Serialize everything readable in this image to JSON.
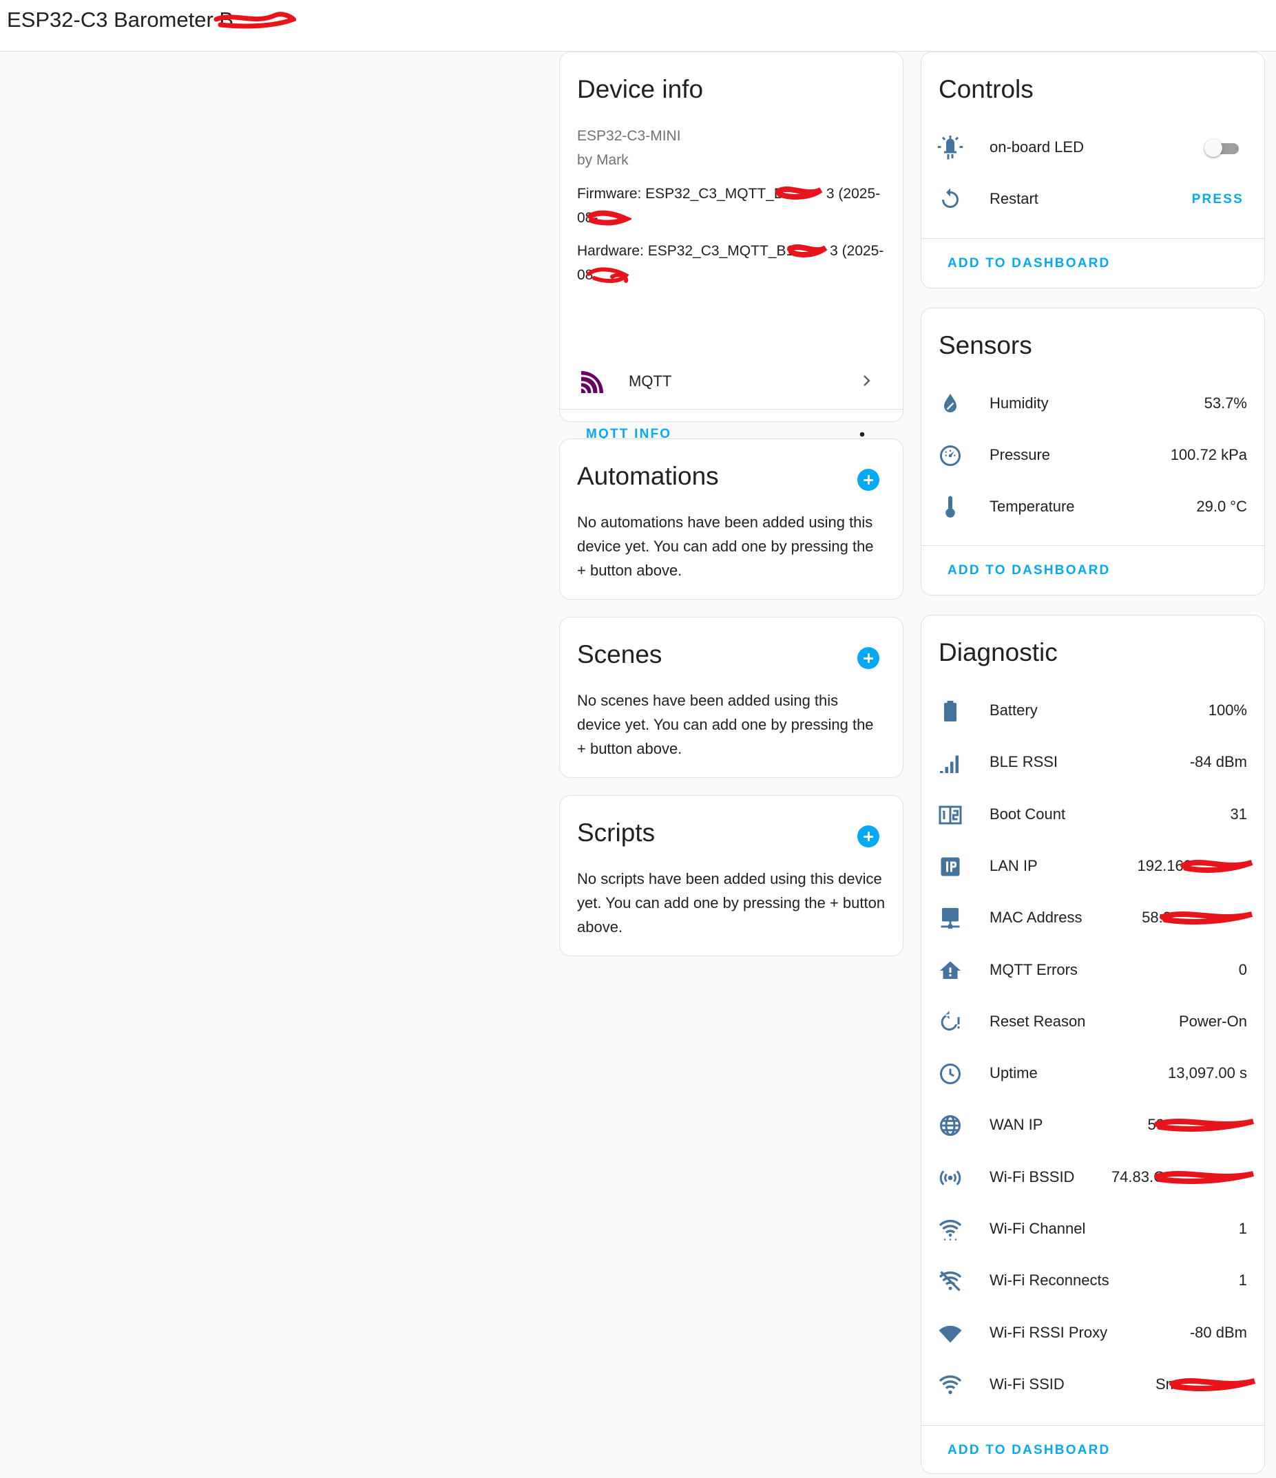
{
  "header": {
    "title": "ESP32-C3 Barometer B"
  },
  "device_info": {
    "title": "Device info",
    "model": "ESP32-C3-MINI",
    "manufacturer": "by Mark",
    "firmware_line1": "Firmware: ESP32_C3_MQTT_B",
    "firmware_line1_tail": "3 (2025-",
    "firmware_line2": "08-",
    "hardware_line1": "Hardware: ESP32_C3_MQTT_B1",
    "hardware_line1_tail": "3 (2025-",
    "hardware_line2": "08",
    "integration_label": "MQTT",
    "mqtt_info_label": "MQTT INFO"
  },
  "automations": {
    "title": "Automations",
    "empty_text": "No automations have been added using this device yet. You can add one by pressing the + button above."
  },
  "scenes": {
    "title": "Scenes",
    "empty_text": "No scenes have been added using this device yet. You can add one by pressing the + button above."
  },
  "scripts": {
    "title": "Scripts",
    "empty_text": "No scripts have been added using this device yet. You can add one by pressing the + button above."
  },
  "controls": {
    "title": "Controls",
    "led_label": "on-board LED",
    "led_on": false,
    "restart_label": "Restart",
    "press_label": "PRESS",
    "add_label": "ADD TO DASHBOARD"
  },
  "sensors": {
    "title": "Sensors",
    "items": [
      {
        "icon": "water-drop-icon",
        "label": "Humidity",
        "value": "53.7%"
      },
      {
        "icon": "gauge-icon",
        "label": "Pressure",
        "value": "100.72 kPa"
      },
      {
        "icon": "thermometer-icon",
        "label": "Temperature",
        "value": "29.0 °C"
      }
    ],
    "add_label": "ADD TO DASHBOARD"
  },
  "diagnostic": {
    "title": "Diagnostic",
    "items": [
      {
        "icon": "battery-icon",
        "label": "Battery",
        "value": "100%"
      },
      {
        "icon": "signal-bars-icon",
        "label": "BLE RSSI",
        "value": "-84 dBm"
      },
      {
        "icon": "counter-icon",
        "label": "Boot Count",
        "value": "31"
      },
      {
        "icon": "ip-icon",
        "label": "LAN IP",
        "value": "192.168"
      },
      {
        "icon": "network-icon",
        "label": "MAC Address",
        "value": "58:8"
      },
      {
        "icon": "alert-home-icon",
        "label": "MQTT Errors",
        "value": "0"
      },
      {
        "icon": "restart-alert-icon",
        "label": "Reset Reason",
        "value": "Power-On"
      },
      {
        "icon": "clock-icon",
        "label": "Uptime",
        "value": "13,097.00 s"
      },
      {
        "icon": "globe-icon",
        "label": "WAN IP",
        "value": "59"
      },
      {
        "icon": "access-point-icon",
        "label": "Wi-Fi BSSID",
        "value": "74.83.C"
      },
      {
        "icon": "wifi-channel-icon",
        "label": "Wi-Fi Channel",
        "value": "1"
      },
      {
        "icon": "wifi-off-icon",
        "label": "Wi-Fi Reconnects",
        "value": "1"
      },
      {
        "icon": "wifi-strength-icon",
        "label": "Wi-Fi RSSI Proxy",
        "value": "-80 dBm"
      },
      {
        "icon": "wifi-icon",
        "label": "Wi-Fi SSID",
        "value": "Sm"
      }
    ],
    "add_label": "ADD TO DASHBOARD"
  },
  "colors": {
    "accent": "#03a9f4",
    "icon": "#44739e",
    "mqtt_logo": "#660066",
    "redaction": "#e8141c"
  }
}
